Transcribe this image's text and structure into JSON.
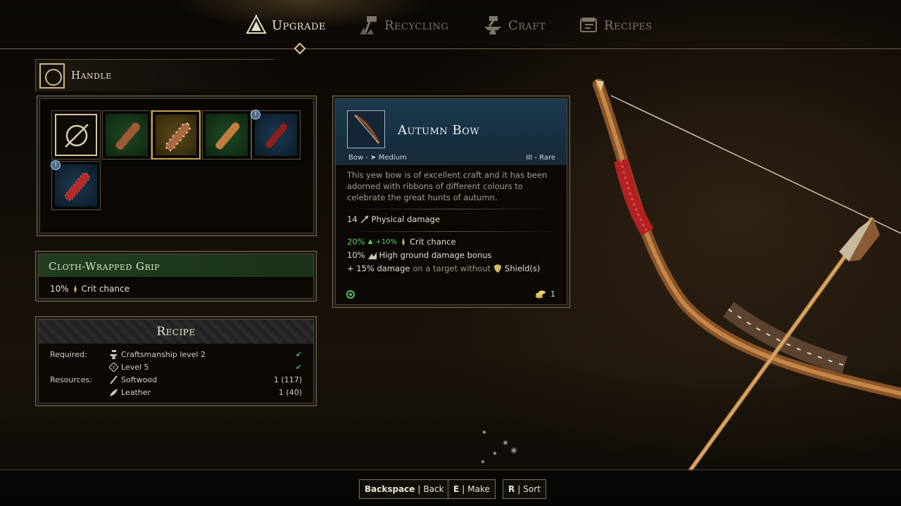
{
  "nav": {
    "tabs": [
      {
        "label": "Upgrade",
        "icon": "upgrade-icon",
        "active": true
      },
      {
        "label": "Recycling",
        "icon": "recycling-icon",
        "active": false
      },
      {
        "label": "Craft",
        "icon": "anvil-icon",
        "active": false
      },
      {
        "label": "Recipes",
        "icon": "recipes-icon",
        "active": false
      }
    ]
  },
  "handle": {
    "title": "Handle"
  },
  "handle_grid": {
    "slots": [
      {
        "kind": "none",
        "selected": false,
        "new": false
      },
      {
        "kind": "green",
        "selected": false,
        "new": false
      },
      {
        "kind": "gold",
        "selected": true,
        "new": false
      },
      {
        "kind": "green",
        "selected": false,
        "new": false
      },
      {
        "kind": "blue",
        "selected": false,
        "new": true
      },
      {
        "kind": "blue",
        "selected": false,
        "new": true
      }
    ],
    "new_badge": "!"
  },
  "grip": {
    "title": "Cloth-Wrapped Grip",
    "stat_value": "10%",
    "stat_label": "Crit chance"
  },
  "recipe": {
    "title": "Recipe",
    "required_label": "Required:",
    "resources_label": "Resources:",
    "requirements": [
      {
        "text": "Craftsmanship level 2",
        "met": true
      },
      {
        "text": "Level 5",
        "met": true
      }
    ],
    "resources": [
      {
        "name": "Softwood",
        "amount": "1 (117)"
      },
      {
        "name": "Leather",
        "amount": "1 (40)"
      }
    ]
  },
  "item": {
    "name": "Autumn Bow",
    "type": "Bow -",
    "weight": "Medium",
    "rarity": "III - Rare",
    "description": "This yew bow is of excellent craft and it has been adorned with ribbons of different colours to celebrate the great hunts of autumn.",
    "damage_value": "14",
    "damage_label": "Physical damage",
    "crit_value": "20%",
    "crit_bonus": "+10%",
    "crit_label": "Crit chance",
    "highground_value": "10%",
    "highground_label": "High ground damage bonus",
    "shield_prefix": "+ 15% damage",
    "shield_mid": "on a target without",
    "shield_label": "Shield(s)",
    "cost": "1"
  },
  "footer": {
    "buttons": [
      {
        "key": "Backspace",
        "label": "Back"
      },
      {
        "key": "E",
        "label": "Make"
      },
      {
        "key": "R",
        "label": "Sort"
      }
    ]
  },
  "colors": {
    "accent_gold": "#d8c79b",
    "rare_blue": "#1c3a4e",
    "uncommon_green": "#213d1e",
    "check_green": "#3fb457"
  }
}
